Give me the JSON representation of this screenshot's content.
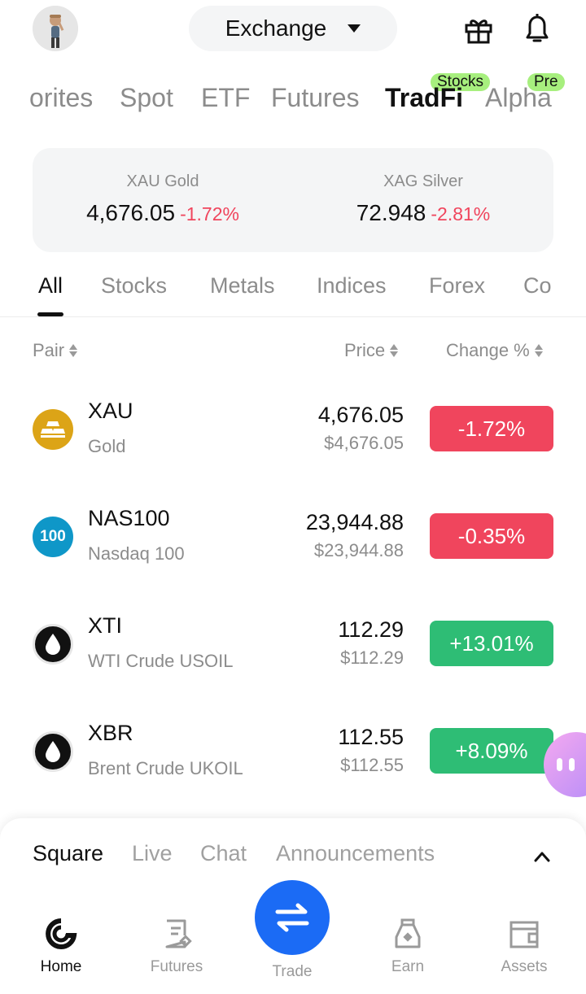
{
  "header": {
    "exchange_label": "Exchange"
  },
  "top_tabs": [
    {
      "label": "orites"
    },
    {
      "label": "Spot"
    },
    {
      "label": "ETF"
    },
    {
      "label": "Futures"
    },
    {
      "label": "TradFi",
      "tag": "Stocks"
    },
    {
      "label": "Alpha",
      "tag": "Pre"
    }
  ],
  "metals": [
    {
      "name": "XAU Gold",
      "price": "4,676.05",
      "change": "-1.72%"
    },
    {
      "name": "XAG Silver",
      "price": "72.948",
      "change": "-2.81%"
    }
  ],
  "categories": [
    "All",
    "Stocks",
    "Metals",
    "Indices",
    "Forex",
    "Co"
  ],
  "columns": {
    "pair": "Pair",
    "price": "Price",
    "change": "Change %"
  },
  "rows": [
    {
      "symbol": "XAU",
      "name": "Gold",
      "price": "4,676.05",
      "usd": "$4,676.05",
      "change": "-1.72%",
      "direction": "down",
      "icon": "gold-bars-icon"
    },
    {
      "symbol": "NAS100",
      "name": "Nasdaq 100",
      "price": "23,944.88",
      "usd": "$23,944.88",
      "change": "-0.35%",
      "direction": "down",
      "icon": "nasdaq-100-icon",
      "icon_text": "100"
    },
    {
      "symbol": "XTI",
      "name": "WTI Crude USOIL",
      "price": "112.29",
      "usd": "$112.29",
      "change": "+13.01%",
      "direction": "up",
      "icon": "oil-drop-icon"
    },
    {
      "symbol": "XBR",
      "name": "Brent Crude UKOIL",
      "price": "112.55",
      "usd": "$112.55",
      "change": "+8.09%",
      "direction": "up",
      "icon": "oil-drop-icon"
    }
  ],
  "sheet_tabs": [
    "Square",
    "Live",
    "Chat",
    "Announcements"
  ],
  "bottom_nav": [
    {
      "label": "Home",
      "icon": "home-icon"
    },
    {
      "label": "Futures",
      "icon": "futures-icon"
    },
    {
      "label": "Trade",
      "icon": "trade-swap-icon"
    },
    {
      "label": "Earn",
      "icon": "earn-bag-icon"
    },
    {
      "label": "Assets",
      "icon": "wallet-icon"
    }
  ],
  "colors": {
    "down": "#f0455d",
    "up": "#2ebd75",
    "accent": "#1b6bf5",
    "tag": "#a7ef7e"
  }
}
